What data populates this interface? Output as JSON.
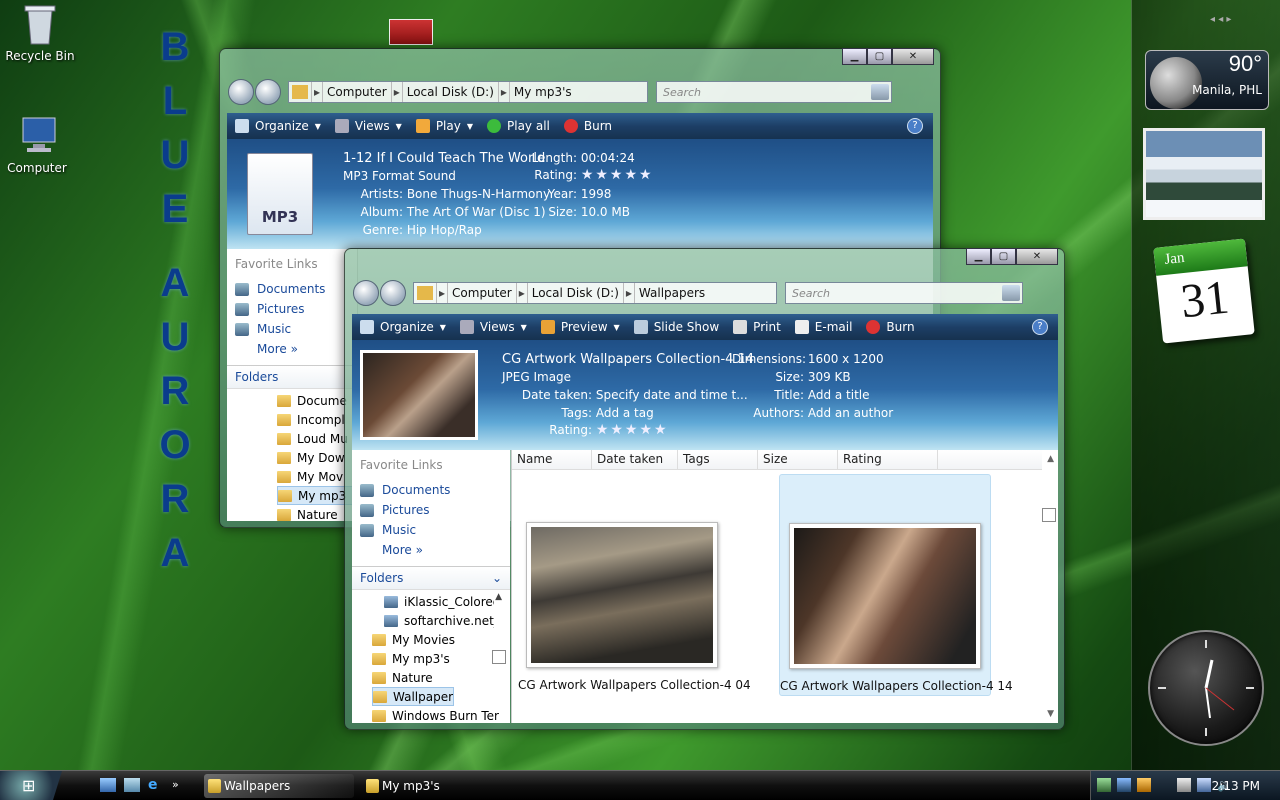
{
  "desktop": {
    "icons": [
      {
        "label": "Recycle Bin"
      },
      {
        "label": "Computer"
      }
    ],
    "aurora_text": [
      "B",
      "L",
      "U",
      "E",
      "A",
      "U",
      "R",
      "O",
      "R",
      "A"
    ]
  },
  "sidebar": {
    "weather": {
      "temp": "90°",
      "location": "Manila, PHL"
    },
    "calendar": {
      "month": "Jan",
      "day": "31"
    }
  },
  "back_window": {
    "breadcrumb": [
      "Computer",
      "Local Disk (D:)",
      "My mp3's"
    ],
    "search_placeholder": "Search",
    "toolbar": [
      "Organize",
      "Views",
      "Play",
      "Play all",
      "Burn"
    ],
    "file": {
      "title": "1-12 If I Could Teach The World",
      "type": "MP3 Format Sound",
      "thumb_label": "MP3",
      "fields": [
        {
          "label": "Artists:",
          "value": "Bone Thugs-N-Harmony"
        },
        {
          "label": "Album:",
          "value": "The Art Of War (Disc 1)"
        },
        {
          "label": "Genre:",
          "value": "Hip Hop/Rap"
        }
      ],
      "right_fields": [
        {
          "label": "Length:",
          "value": "00:04:24"
        },
        {
          "label": "Rating:",
          "value": "★★★★★"
        },
        {
          "label": "Year:",
          "value": "1998"
        },
        {
          "label": "Size:",
          "value": "10.0 MB"
        }
      ]
    },
    "favorites_header": "Favorite Links",
    "favorites": [
      "Documents",
      "Pictures",
      "Music"
    ],
    "more": "More",
    "folders_header": "Folders",
    "folders": [
      "Docume",
      "Incompl",
      "Loud Mu",
      "My Dow",
      "My Mov",
      "My mp3",
      "Nature"
    ],
    "selected_folder": 5
  },
  "front_window": {
    "breadcrumb": [
      "Computer",
      "Local Disk (D:)",
      "Wallpapers"
    ],
    "search_placeholder": "Search",
    "toolbar": [
      "Organize",
      "Views",
      "Preview",
      "Slide Show",
      "Print",
      "E-mail",
      "Burn"
    ],
    "file": {
      "title": "CG Artwork Wallpapers Collection-4 14",
      "type": "JPEG Image",
      "fields": [
        {
          "label": "Date taken:",
          "value": "Specify date and time t..."
        },
        {
          "label": "Tags:",
          "value": "Add a tag"
        },
        {
          "label": "Rating:",
          "value": "★★★★★"
        }
      ],
      "right_fields": [
        {
          "label": "Dimensions:",
          "value": "1600 x 1200"
        },
        {
          "label": "Size:",
          "value": "309 KB"
        },
        {
          "label": "Title:",
          "value": "Add a title"
        },
        {
          "label": "Authors:",
          "value": "Add an author"
        }
      ]
    },
    "favorites_header": "Favorite Links",
    "favorites": [
      "Documents",
      "Pictures",
      "Music"
    ],
    "more": "More",
    "folders_header": "Folders",
    "folders": [
      "iKlassic_Colored_",
      "softarchive.net_I",
      "My Movies",
      "My mp3's",
      "Nature",
      "Wallpapers",
      "Windows Burn Ter"
    ],
    "selected_folder": 5,
    "columns": [
      "Name",
      "Date taken",
      "Tags",
      "Size",
      "Rating"
    ],
    "items": [
      "CG Artwork Wallpapers Collection-4 04",
      "CG Artwork Wallpapers Collection-4 14"
    ]
  },
  "taskbar": {
    "buttons": [
      "Wallpapers",
      "My mp3's"
    ],
    "clock": "2:13 PM"
  }
}
